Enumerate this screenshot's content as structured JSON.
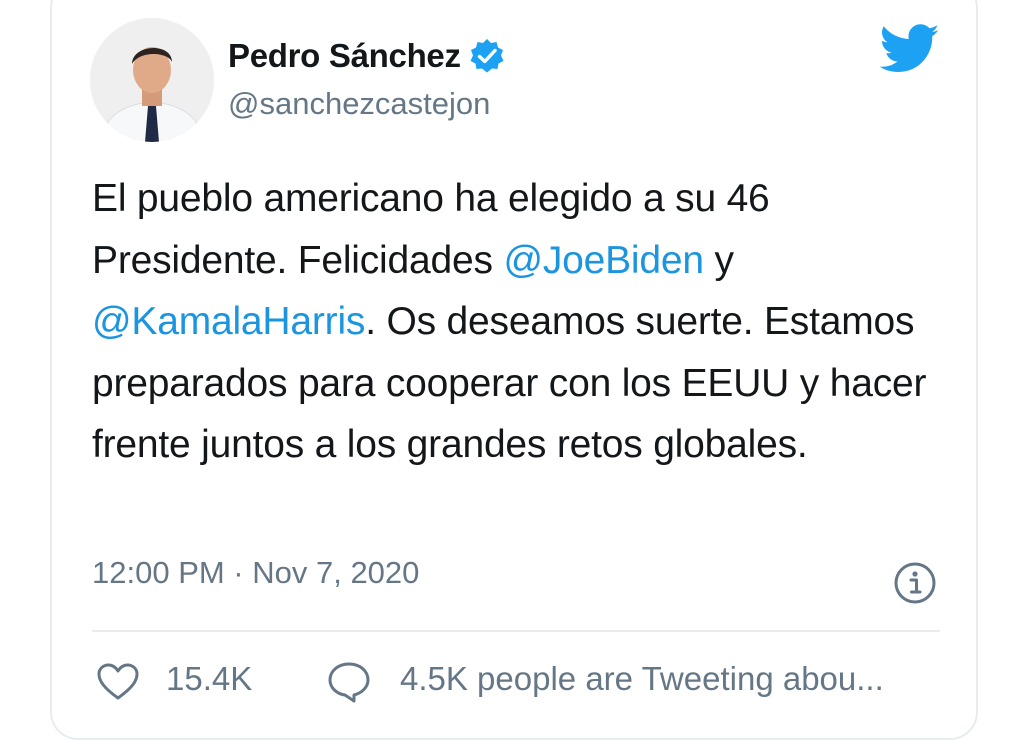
{
  "author": {
    "name": "Pedro Sánchez",
    "handle": "@sanchezcastejon"
  },
  "tweet": {
    "segments": [
      {
        "type": "text",
        "value": "El pueblo americano ha elegido a su 46 Presidente. Felicidades "
      },
      {
        "type": "mention",
        "value": "@JoeBiden"
      },
      {
        "type": "text",
        "value": " y "
      },
      {
        "type": "mention",
        "value": "@KamalaHarris"
      },
      {
        "type": "text",
        "value": ". Os deseamos suerte. Estamos preparados para cooperar con los EEUU y hacer frente juntos a los grandes retos globales."
      }
    ],
    "timestamp": "12:00 PM · Nov 7, 2020"
  },
  "engagement": {
    "likes": "15.4K",
    "tweeting": "4.5K people are Tweeting abou..."
  },
  "colors": {
    "text": "#14171a",
    "secondary": "#657786",
    "link": "#1b95e0",
    "brand": "#1da1f2",
    "border": "#e6ecf0"
  },
  "icons": {
    "brand": "twitter-bird-icon",
    "verified": "verified-badge-icon",
    "info": "info-icon",
    "like": "heart-icon",
    "reply": "speech-bubble-icon"
  }
}
